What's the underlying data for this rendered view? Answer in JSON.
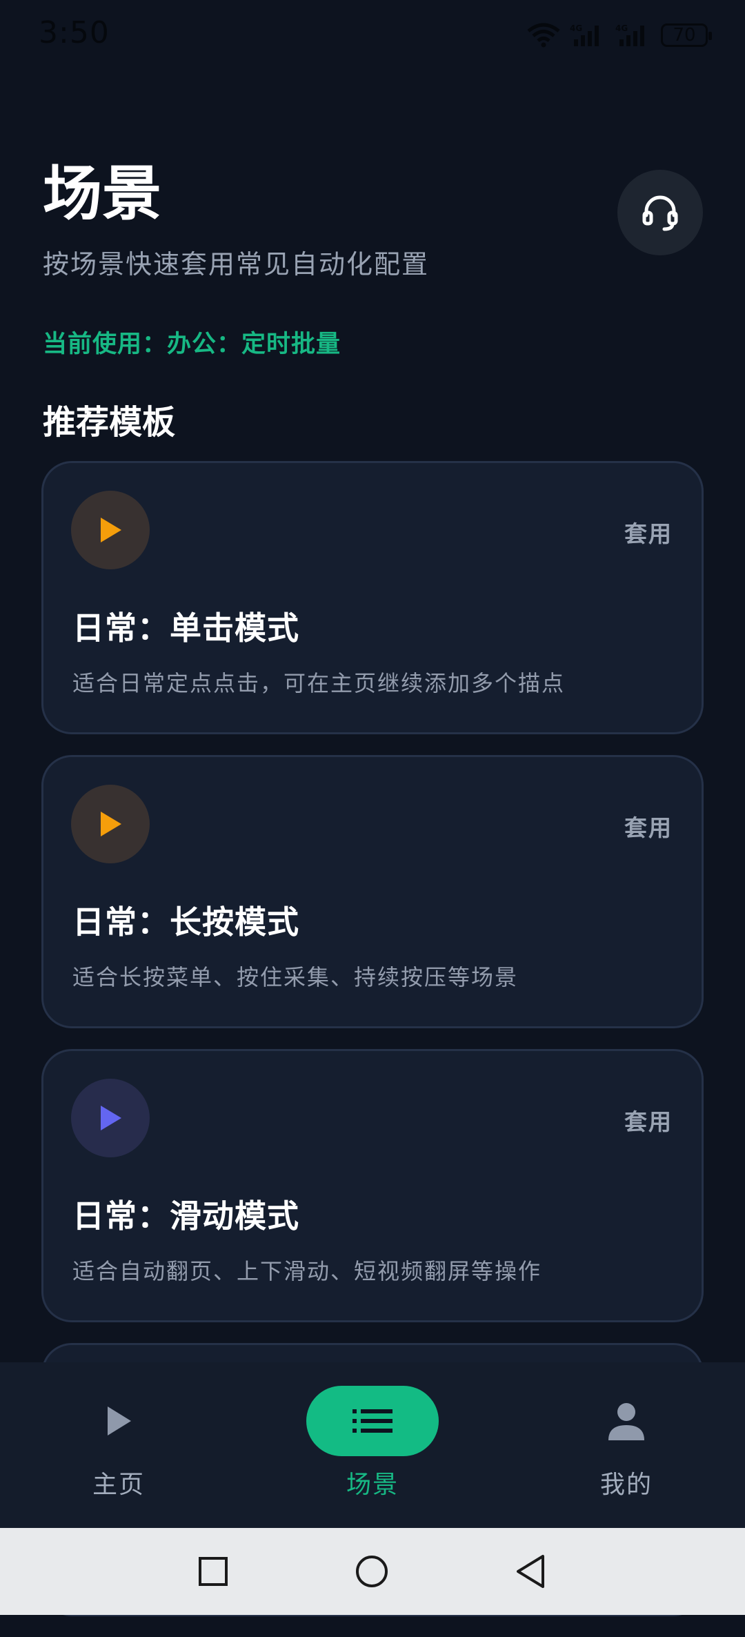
{
  "status_bar": {
    "time": "3:50",
    "battery": "70",
    "network_labels": [
      "4G",
      "4G"
    ]
  },
  "header": {
    "title": "场景",
    "subtitle": "按场景快速套用常见自动化配置",
    "support_icon": "headset-icon"
  },
  "current": {
    "text": "当前使用：办公：定时批量"
  },
  "section": {
    "title": "推荐模板"
  },
  "templates": [
    {
      "title": "日常：单击模式",
      "description": "适合日常定点点击，可在主页继续添加多个描点",
      "action": "套用",
      "icon": "play-icon",
      "icon_color": "#f59e0b",
      "icon_bg": "#383130"
    },
    {
      "title": "日常：长按模式",
      "description": "适合长按菜单、按住采集、持续按压等场景",
      "action": "套用",
      "icon": "play-icon",
      "icon_color": "#f59e0b",
      "icon_bg": "#383130"
    },
    {
      "title": "日常：滑动模式",
      "description": "适合自动翻页、上下滑动、短视频翻屏等操作",
      "action": "套用",
      "icon": "play-icon",
      "icon_color": "#6366f1",
      "icon_bg": "#272c4c"
    }
  ],
  "bottom_nav": {
    "items": [
      {
        "label": "主页",
        "icon": "play-icon",
        "active": false
      },
      {
        "label": "场景",
        "icon": "list-icon",
        "active": true
      },
      {
        "label": "我的",
        "icon": "person-icon",
        "active": false
      }
    ]
  },
  "system_nav": {
    "buttons": [
      "square-icon",
      "circle-icon",
      "back-triangle-icon"
    ]
  },
  "colors": {
    "background": "#0d131f",
    "card_bg": "#151e2f",
    "card_border": "#253148",
    "accent": "#13bb84",
    "text_muted": "#99a3b3"
  }
}
